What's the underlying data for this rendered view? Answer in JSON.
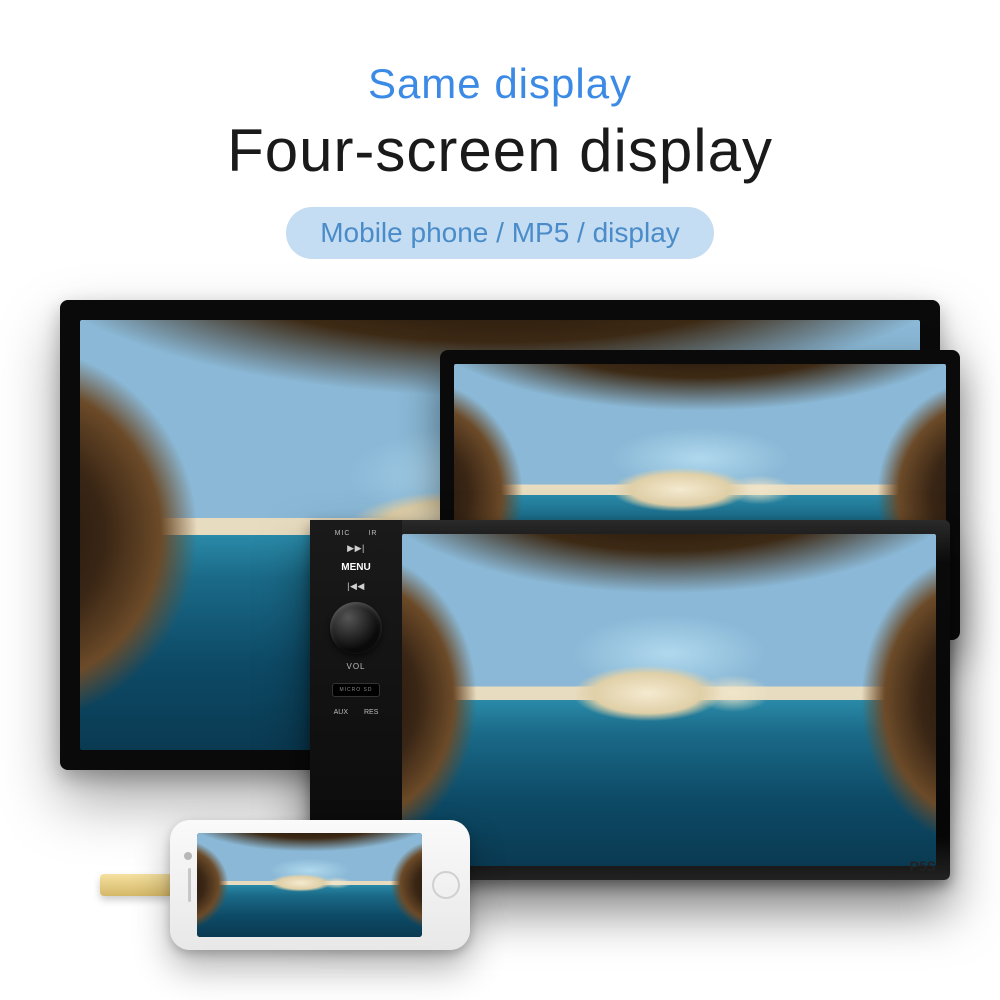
{
  "header": {
    "subtitle": "Same display",
    "title": "Four-screen display",
    "pill": "Mobile phone / MP5 / display"
  },
  "colors": {
    "accent_blue": "#3b8ae6",
    "pill_bg": "#c5ddf2",
    "pill_text": "#4a8cc9"
  },
  "headunit": {
    "top_labels": [
      "MIC",
      "IR"
    ],
    "menu": "MENU",
    "prev": "▶▶|",
    "next": "|◀◀",
    "vol": "VOL",
    "slot": "MICRO SD",
    "aux": "AUX",
    "res": "RES",
    "badge": "P5S"
  },
  "devices": {
    "back_tablet": "tablet-display-back",
    "front_tablet": "tablet-display-front",
    "headunit": "car-mp5-headunit",
    "phone": "mobile-phone"
  }
}
